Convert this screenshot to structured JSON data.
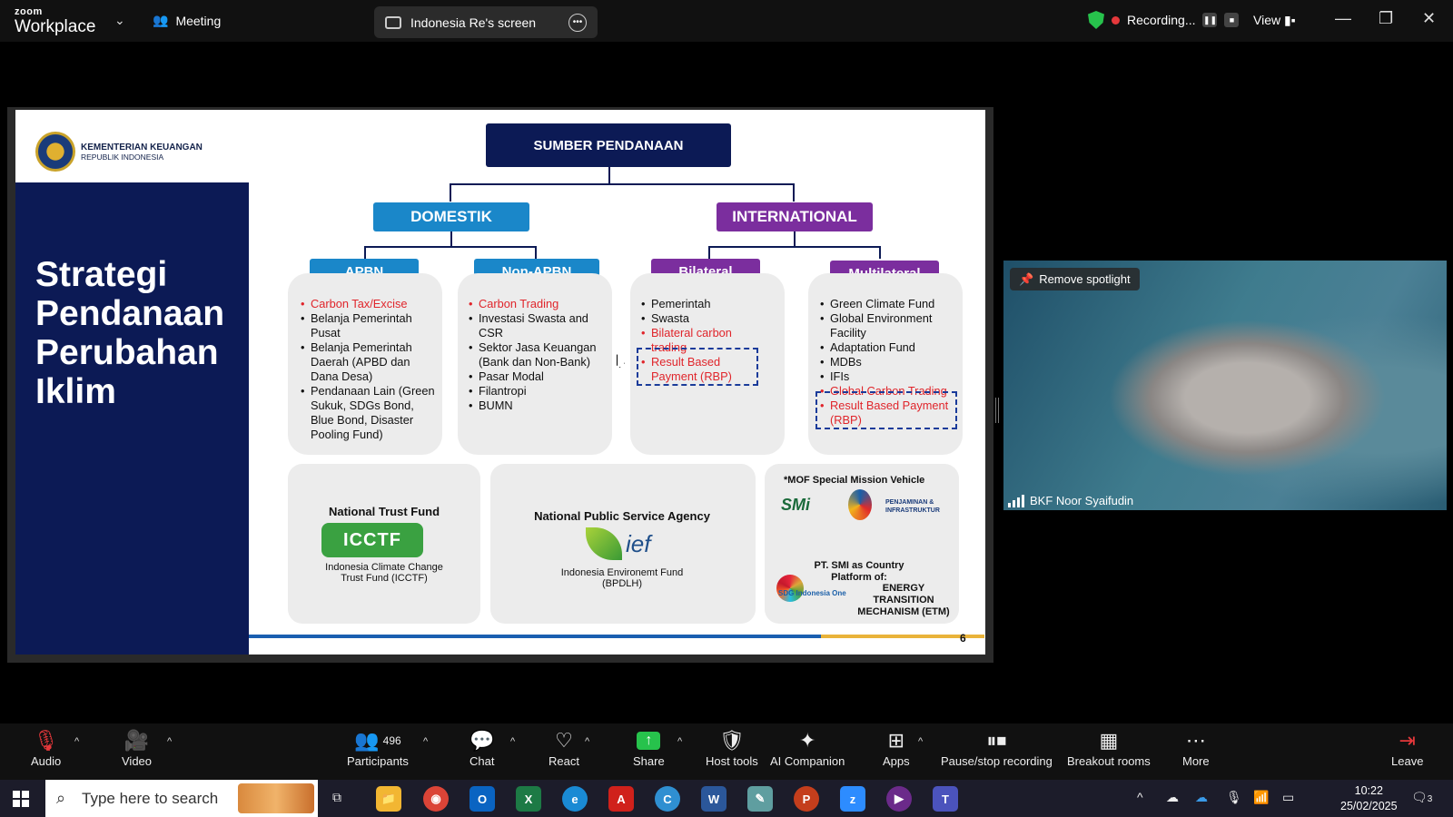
{
  "app": {
    "brand_small": "zoom",
    "brand_big": "Workplace",
    "meeting_label": "Meeting"
  },
  "share_pill": {
    "label": "Indonesia Re's screen"
  },
  "recording": {
    "label": "Recording..."
  },
  "view_label": "View",
  "slide": {
    "ministry_line1": "KEMENTERIAN KEUANGAN",
    "ministry_line2": "REPUBLIK INDONESIA",
    "title": "Strategi Pendanaan Perubahan Iklim",
    "root": "SUMBER PENDANAAN",
    "domestik": "DOMESTIK",
    "international": "INTERNATIONAL",
    "apbn": {
      "label": "APBN",
      "items": [
        {
          "text": "Carbon Tax/Excise",
          "red": true
        },
        {
          "text": "Belanja Pemerintah Pusat",
          "red": false
        },
        {
          "text": "Belanja Pemerintah Daerah (APBD dan Dana Desa)",
          "red": false
        },
        {
          "text": "Pendanaan Lain (Green Sukuk, SDGs Bond, Blue Bond, Disaster Pooling Fund)",
          "red": false
        }
      ]
    },
    "nonapbn": {
      "label": "Non-APBN",
      "items": [
        {
          "text": "Carbon Trading",
          "red": true
        },
        {
          "text": "Investasi Swasta and CSR",
          "red": false
        },
        {
          "text": "Sektor Jasa Keuangan (Bank dan Non-Bank)",
          "red": false
        },
        {
          "text": "Pasar Modal",
          "red": false
        },
        {
          "text": "Filantropi",
          "red": false
        },
        {
          "text": "BUMN",
          "red": false
        }
      ]
    },
    "bilateral": {
      "label": "Bilateral",
      "items": [
        {
          "text": "Pemerintah",
          "red": false
        },
        {
          "text": "Swasta",
          "red": false
        },
        {
          "text": "Bilateral carbon trading",
          "red": true
        },
        {
          "text": "Result Based Payment (RBP)",
          "red": true
        }
      ]
    },
    "multilateral": {
      "label": "Multilateral",
      "items": [
        {
          "text": "Green Climate Fund",
          "red": false
        },
        {
          "text": "Global Environment Facility",
          "red": false
        },
        {
          "text": "Adaptation Fund",
          "red": false
        },
        {
          "text": "MDBs",
          "red": false
        },
        {
          "text": "IFIs",
          "red": false
        },
        {
          "text": "Global Carbon Trading",
          "red": true
        },
        {
          "text": "Result Based Payment (RBP)",
          "red": true
        }
      ]
    },
    "ntf": {
      "title": "National Trust Fund",
      "logo": "ICCTF",
      "caption": "Indonesia Climate Change Trust Fund (ICCTF)"
    },
    "npsa": {
      "title": "National Public Service Agency",
      "logo": "ief",
      "caption": "Indonesia Environemt Fund (BPDLH)"
    },
    "smv": {
      "title": "*MOF Special Mission Vehicle",
      "smi_logo": "SMi",
      "pii": "PENJAMINAN & INFRASTRUKTUR",
      "platform": "PT. SMI as Country Platform of:",
      "sdg": "SDG Indonesia One",
      "etm": "ENERGY TRANSITION MECHANISM (ETM)"
    },
    "page_number": "6"
  },
  "video": {
    "spotlight_label": "Remove spotlight",
    "participant_name": "BKF Noor Syaifudin"
  },
  "toolbar": {
    "audio": "Audio",
    "video": "Video",
    "participants": "Participants",
    "participants_count": "496",
    "chat": "Chat",
    "react": "React",
    "share": "Share",
    "host_tools": "Host tools",
    "ai_companion": "AI Companion",
    "apps": "Apps",
    "pause_rec": "Pause/stop recording",
    "breakout": "Breakout rooms",
    "more": "More",
    "leave": "Leave"
  },
  "taskbar": {
    "search_placeholder": "Type here to search",
    "time": "10:22",
    "date": "25/02/2025",
    "notifications": "3"
  },
  "colors": {
    "navy": "#0c1a55",
    "blue": "#1a87c9",
    "purple": "#7b2e9e",
    "red": "#e0252b",
    "rec_green": "#27c24c"
  }
}
